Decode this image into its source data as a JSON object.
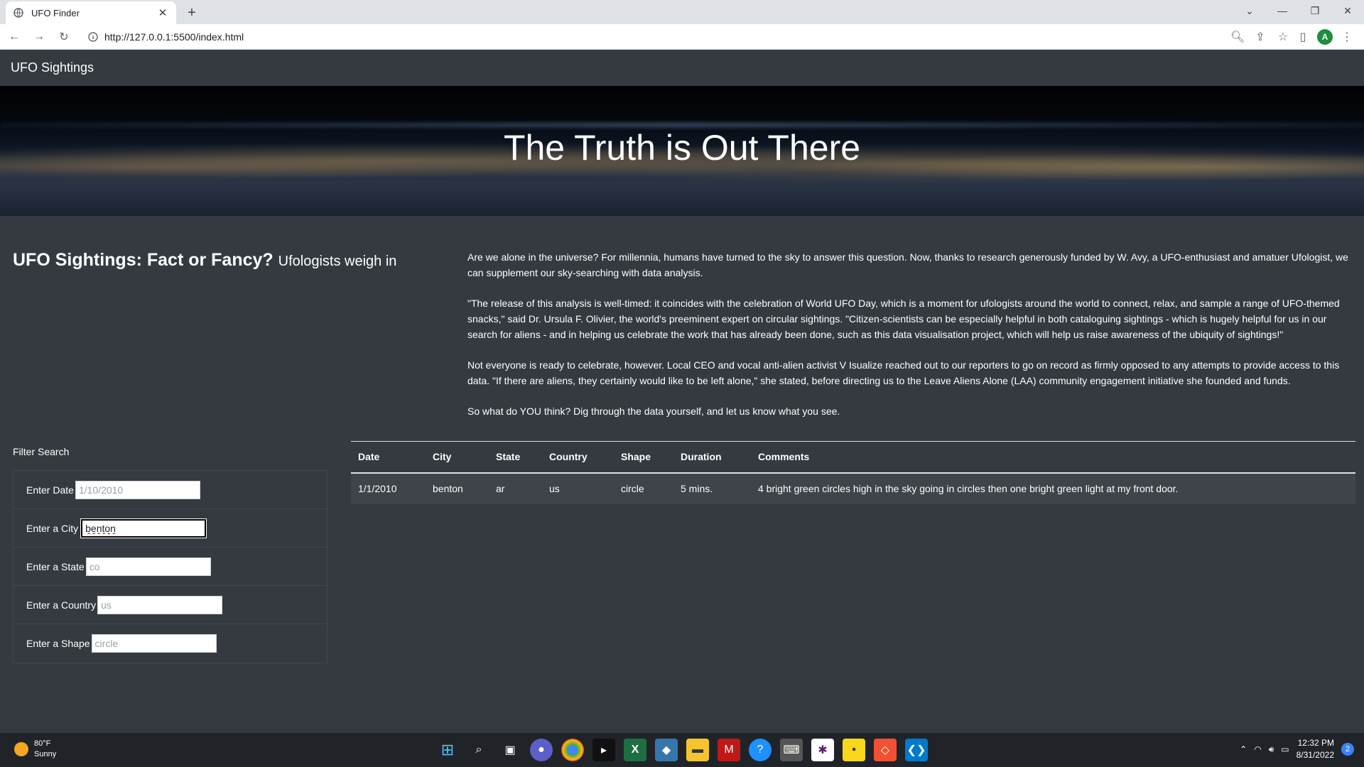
{
  "browser": {
    "tab_title": "UFO Finder",
    "url": "http://127.0.0.1:5500/index.html",
    "avatar_letter": "A"
  },
  "navbar": {
    "brand": "UFO Sightings"
  },
  "hero": {
    "title": "The Truth is Out There"
  },
  "article": {
    "title": "UFO Sightings: Fact or Fancy?",
    "subtitle": "Ufologists weigh in",
    "paragraphs": [
      "Are we alone in the universe? For millennia, humans have turned to the sky to answer this question. Now, thanks to research generously funded by W. Avy, a UFO-enthusiast and amatuer Ufologist, we can supplement our sky-searching with data analysis.",
      "\"The release of this analysis is well-timed: it coincides with the celebration of World UFO Day, which is a moment for ufologists around the world to connect, relax, and sample a range of UFO-themed snacks,\" said Dr. Ursula F. Olivier, the world's preeminent expert on circular sightings. \"Citizen-scientists can be especially helpful in both cataloguing sightings - which is hugely helpful for us in our search for aliens - and in helping us celebrate the work that has already been done, such as this data visualisation project, which will help us raise awareness of the ubiquity of sightings!\"",
      "Not everyone is ready to celebrate, however. Local CEO and vocal anti-alien activist V Isualize reached out to our reporters to go on record as firmly opposed to any attempts to provide access to this data. \"If there are aliens, they certainly would like to be left alone,\" she stated, before directing us to the Leave Aliens Alone (LAA) community engagement initiative she founded and funds.",
      "So what do YOU think? Dig through the data yourself, and let us know what you see."
    ]
  },
  "filters": {
    "heading": "Filter Search",
    "date": {
      "label": "Enter Date",
      "placeholder": "1/10/2010",
      "value": ""
    },
    "city": {
      "label": "Enter a City",
      "placeholder": "",
      "value": "benton"
    },
    "state": {
      "label": "Enter a State",
      "placeholder": "co",
      "value": ""
    },
    "country": {
      "label": "Enter a Country",
      "placeholder": "us",
      "value": ""
    },
    "shape": {
      "label": "Enter a Shape",
      "placeholder": "circle",
      "value": ""
    }
  },
  "table": {
    "headers": [
      "Date",
      "City",
      "State",
      "Country",
      "Shape",
      "Duration",
      "Comments"
    ],
    "rows": [
      [
        "1/1/2010",
        "benton",
        "ar",
        "us",
        "circle",
        "5 mins.",
        "4 bright green circles high in the sky going in circles then one bright green light at my front door."
      ]
    ]
  },
  "taskbar": {
    "weather_temp": "80°F",
    "weather_desc": "Sunny",
    "time": "12:32 PM",
    "date": "8/31/2022",
    "notification_count": "2"
  },
  "colors": {
    "page_bg": "#343a40",
    "taskbar_bg": "#202428",
    "sun": "#f5a623"
  }
}
